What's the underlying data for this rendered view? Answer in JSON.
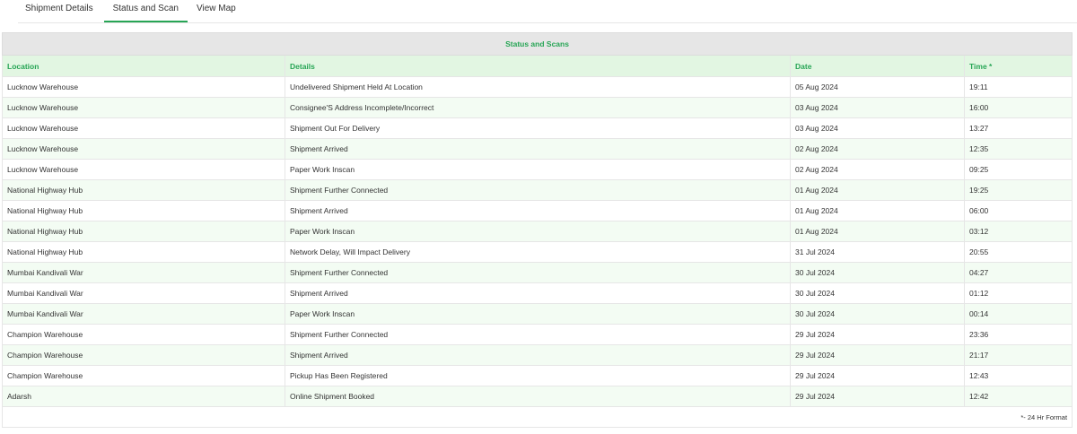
{
  "tabs": [
    {
      "label": "Shipment Details"
    },
    {
      "label": "Status and Scan"
    },
    {
      "label": "View Map"
    }
  ],
  "table": {
    "caption": "Status and Scans",
    "headers": [
      "Location",
      "Details",
      "Date",
      "Time *"
    ],
    "rows": [
      [
        "Lucknow Warehouse",
        "Undelivered Shipment Held At Location",
        "05 Aug 2024",
        "19:11"
      ],
      [
        "Lucknow Warehouse",
        "Consignee'S Address Incomplete/Incorrect",
        "03 Aug 2024",
        "16:00"
      ],
      [
        "Lucknow Warehouse",
        "Shipment Out For Delivery",
        "03 Aug 2024",
        "13:27"
      ],
      [
        "Lucknow Warehouse",
        "Shipment Arrived",
        "02 Aug 2024",
        "12:35"
      ],
      [
        "Lucknow Warehouse",
        "Paper Work Inscan",
        "02 Aug 2024",
        "09:25"
      ],
      [
        "National Highway Hub",
        "Shipment Further Connected",
        "01 Aug 2024",
        "19:25"
      ],
      [
        "National Highway Hub",
        "Shipment Arrived",
        "01 Aug 2024",
        "06:00"
      ],
      [
        "National Highway Hub",
        "Paper Work Inscan",
        "01 Aug 2024",
        "03:12"
      ],
      [
        "National Highway Hub",
        "Network Delay, Will Impact Delivery",
        "31 Jul 2024",
        "20:55"
      ],
      [
        "Mumbai Kandivali War",
        "Shipment Further Connected",
        "30 Jul 2024",
        "04:27"
      ],
      [
        "Mumbai Kandivali War",
        "Shipment Arrived",
        "30 Jul 2024",
        "01:12"
      ],
      [
        "Mumbai Kandivali War",
        "Paper Work Inscan",
        "30 Jul 2024",
        "00:14"
      ],
      [
        "Champion Warehouse",
        "Shipment Further Connected",
        "29 Jul 2024",
        "23:36"
      ],
      [
        "Champion Warehouse",
        "Shipment Arrived",
        "29 Jul 2024",
        "21:17"
      ],
      [
        "Champion Warehouse",
        "Pickup Has Been Registered",
        "29 Jul 2024",
        "12:43"
      ],
      [
        "Adarsh",
        "Online Shipment Booked",
        "29 Jul 2024",
        "12:42"
      ]
    ],
    "footnote": "*- 24 Hr Format"
  },
  "colors": {
    "accent": "#27a555",
    "header_bg": "#e2f6e2",
    "caption_bg": "#e6e6e6",
    "alt_row_bg": "#f3fcf3"
  }
}
